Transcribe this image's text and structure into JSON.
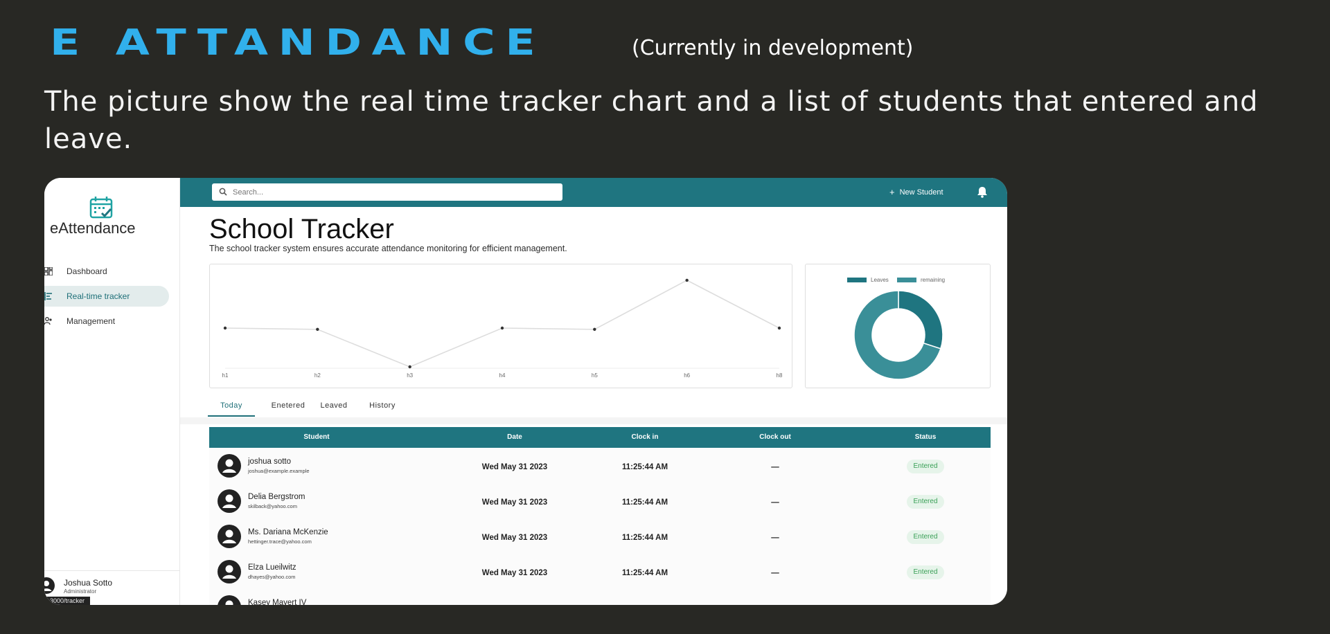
{
  "slide": {
    "title": "E ATTANDANCE",
    "subtitle": "(Currently in development)",
    "description": "The picture show the real time tracker chart and a list of students that entered and leave."
  },
  "app": {
    "name": "eAttendance",
    "sidebar": {
      "items": [
        {
          "label": "Dashboard",
          "icon": "dashboard-icon",
          "active": false
        },
        {
          "label": "Real-time tracker",
          "icon": "tracker-icon",
          "active": true
        },
        {
          "label": "Management",
          "icon": "people-icon",
          "active": false
        }
      ],
      "user": {
        "name": "Joshua Sotto",
        "role": "Administrator"
      },
      "url_tooltip": "3000/tracker"
    },
    "topbar": {
      "search_placeholder": "Search...",
      "new_student_label": "New Student"
    },
    "page": {
      "title": "School Tracker",
      "subtitle": "The school tracker system ensures accurate attendance monitoring for efficient management."
    },
    "tabs": [
      "Today",
      "Enetered",
      "Leaved",
      "History"
    ],
    "table": {
      "headers": [
        "Student",
        "Date",
        "Clock in",
        "Clock out",
        "Status"
      ],
      "rows": [
        {
          "name": "joshua sotto",
          "email": "joshua@example.example",
          "date": "Wed May 31 2023",
          "clock_in": "11:25:44 AM",
          "clock_out": "—",
          "status": "Entered"
        },
        {
          "name": "Delia Bergstrom",
          "email": "skilback@yahoo.com",
          "date": "Wed May 31 2023",
          "clock_in": "11:25:44 AM",
          "clock_out": "—",
          "status": "Entered"
        },
        {
          "name": "Ms. Dariana McKenzie",
          "email": "hettinger.trace@yahoo.com",
          "date": "Wed May 31 2023",
          "clock_in": "11:25:44 AM",
          "clock_out": "—",
          "status": "Entered"
        },
        {
          "name": "Elza Lueilwitz",
          "email": "dhayes@yahoo.com",
          "date": "Wed May 31 2023",
          "clock_in": "11:25:44 AM",
          "clock_out": "—",
          "status": "Entered"
        },
        {
          "name": "Kasey Mayert IV",
          "email": "",
          "date": "",
          "clock_in": "",
          "clock_out": "",
          "status": ""
        }
      ]
    },
    "colors": {
      "accent": "#1f7580",
      "title_blue": "#31b0ec",
      "donut_dark": "#1f7580",
      "donut_light": "#3a8f98"
    }
  },
  "chart_data": [
    {
      "type": "line",
      "x": [
        "h1",
        "h2",
        "h3",
        "h4",
        "h5",
        "h6",
        "h8"
      ],
      "values": [
        3,
        2.9,
        0,
        3,
        2.9,
        6.7,
        3
      ],
      "ylim": [
        0,
        7.5
      ],
      "grid": false,
      "legend": "none"
    },
    {
      "type": "pie",
      "variant": "donut",
      "labels": [
        "Leaves",
        "remaining"
      ],
      "values": [
        30,
        70
      ],
      "legend": "top"
    }
  ]
}
